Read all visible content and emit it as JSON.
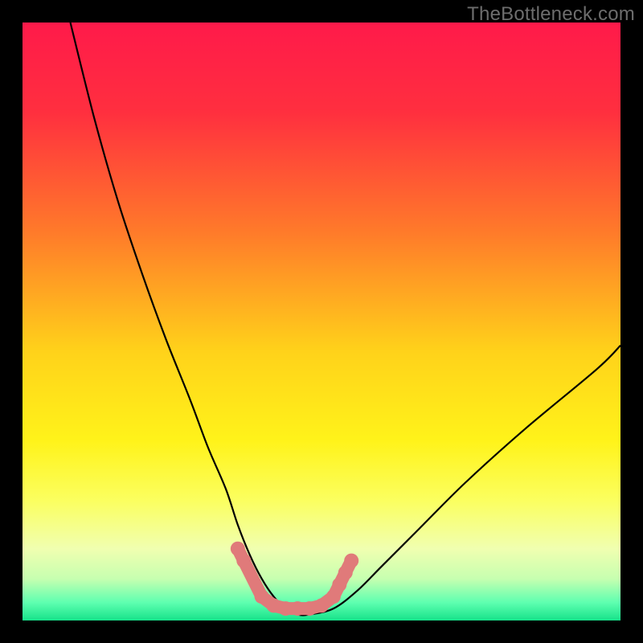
{
  "watermark": "TheBottleneck.com",
  "colors": {
    "frame": "#000000",
    "gradient_stops": [
      {
        "offset": 0.0,
        "color": "#ff1a4a"
      },
      {
        "offset": 0.15,
        "color": "#ff2f3f"
      },
      {
        "offset": 0.35,
        "color": "#ff7a2a"
      },
      {
        "offset": 0.55,
        "color": "#ffd21a"
      },
      {
        "offset": 0.7,
        "color": "#fff31a"
      },
      {
        "offset": 0.8,
        "color": "#fbff60"
      },
      {
        "offset": 0.88,
        "color": "#f0ffb0"
      },
      {
        "offset": 0.93,
        "color": "#c7ffb0"
      },
      {
        "offset": 0.97,
        "color": "#5effb0"
      },
      {
        "offset": 1.0,
        "color": "#16e28a"
      }
    ],
    "curve": "#000000",
    "marker": "#e07a7a"
  },
  "chart_data": {
    "type": "line",
    "title": "",
    "xlabel": "",
    "ylabel": "",
    "xlim": [
      0,
      100
    ],
    "ylim": [
      0,
      100
    ],
    "grid": false,
    "legend": false,
    "series": [
      {
        "name": "bottleneck-curve",
        "x": [
          8,
          12,
          16,
          20,
          24,
          28,
          31,
          34,
          36,
          38,
          40,
          42,
          44,
          46,
          48,
          52,
          56,
          60,
          66,
          74,
          84,
          96,
          100
        ],
        "y": [
          100,
          84,
          70,
          58,
          47,
          37,
          29,
          22,
          16,
          11,
          7,
          4,
          2,
          1,
          1,
          2,
          5,
          9,
          15,
          23,
          32,
          42,
          46
        ]
      }
    ],
    "markers": [
      {
        "x": 36,
        "y": 12
      },
      {
        "x": 37,
        "y": 10
      },
      {
        "x": 40,
        "y": 4
      },
      {
        "x": 42,
        "y": 2.5
      },
      {
        "x": 44,
        "y": 2
      },
      {
        "x": 46,
        "y": 2
      },
      {
        "x": 48,
        "y": 2
      },
      {
        "x": 50,
        "y": 2.5
      },
      {
        "x": 52,
        "y": 4
      },
      {
        "x": 53,
        "y": 6
      },
      {
        "x": 54,
        "y": 8
      },
      {
        "x": 55,
        "y": 10
      }
    ]
  }
}
